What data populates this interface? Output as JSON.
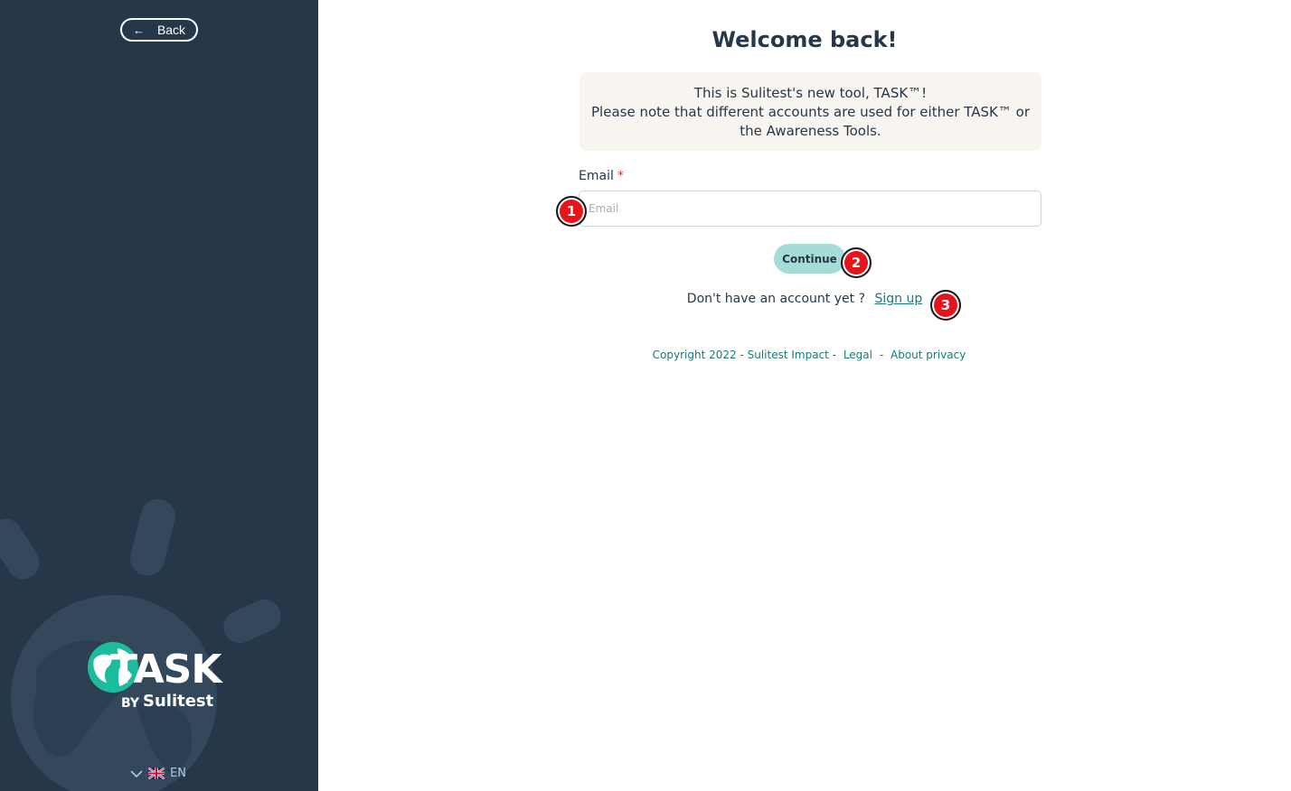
{
  "sidebar": {
    "back_label": "Back",
    "logo": {
      "word": "TASK",
      "by": "BY",
      "brand": "Sulitest"
    },
    "language": "EN"
  },
  "main": {
    "title": "Welcome back!",
    "notice": {
      "line1": "This is Sulitest's new tool, TASK™!",
      "line2": "Please note that different accounts are used for either TASK™ or the Awareness Tools."
    },
    "email": {
      "label": "Email",
      "required_mark": "*",
      "placeholder": "Email",
      "value": ""
    },
    "continue_label": "Continue",
    "signup": {
      "prompt": "Don't have an account yet ?",
      "link": "Sign up"
    },
    "footer": {
      "copyright": "Copyright 2022 - Sulitest Impact -",
      "legal": "Legal",
      "separator": "-",
      "privacy": "About privacy"
    }
  },
  "markers": [
    "1",
    "2",
    "3"
  ],
  "colors": {
    "sidebar_bg": "#27374a",
    "accent_teal": "#1a7a74",
    "button_bg": "#a6dcd6",
    "notice_bg": "#f8f4ef",
    "marker_red": "#e8141c"
  }
}
